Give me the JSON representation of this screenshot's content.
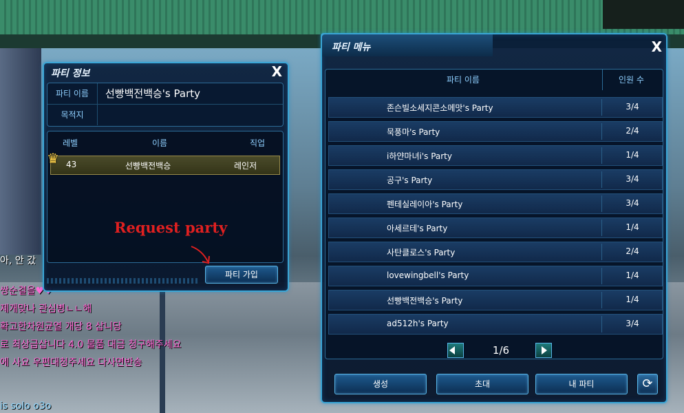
{
  "party_info": {
    "title": "파티 정보",
    "close_label": "X",
    "party_name_label": "파티 이름",
    "party_name_value": "선빵백전백승's Party",
    "destination_label": "목적지",
    "destination_value": "",
    "columns": {
      "level": "레벨",
      "name": "이름",
      "job": "직업"
    },
    "members": [
      {
        "level": "43",
        "name": "선빵백전백승",
        "job": "레인저"
      }
    ],
    "join_button": "파티 가입"
  },
  "annotation": "Request party",
  "party_menu": {
    "title": "파티 메뉴",
    "close_label": "X",
    "columns": {
      "name": "파티 이름",
      "count": "인원 수"
    },
    "parties": [
      {
        "name": "존슨빌소세지콘소메맛's Party",
        "count": "3/4"
      },
      {
        "name": "묵풍마's Party",
        "count": "2/4"
      },
      {
        "name": "i하얀마녀i's Party",
        "count": "1/4"
      },
      {
        "name": "공구's Party",
        "count": "3/4"
      },
      {
        "name": "펜테실레이아's Party",
        "count": "3/4"
      },
      {
        "name": "아세르테's Party",
        "count": "1/4"
      },
      {
        "name": "사탄클로스's Party",
        "count": "2/4"
      },
      {
        "name": "lovewingbell's Party",
        "count": "1/4"
      },
      {
        "name": "선빵백전백승's Party",
        "count": "1/4"
      },
      {
        "name": "ad512h's Party",
        "count": "3/4"
      }
    ],
    "page": "1/6",
    "buttons": {
      "create": "생성",
      "invite": "초대",
      "my_party": "내 파티",
      "refresh_icon": "refresh-icon"
    }
  },
  "chat": [
    {
      "text": "아, 안 갔",
      "color": "#ffffff"
    },
    {
      "text": "쌍순결을♥♥",
      "color": "#ff6ad5"
    },
    {
      "text": "제개맞나 관심병ㄴㄴ해",
      "color": "#ff6ad5"
    },
    {
      "text": "확고한차원균열 개당 8 삽니당",
      "color": "#ff6ad5"
    },
    {
      "text": "로 최상급삽니다 4.0 물품 대금 청구해주세요",
      "color": "#ff6ad5"
    },
    {
      "text": "에 사요 우편대청주세요 다사면반송",
      "color": "#ff6ad5"
    },
    {
      "text": "is solo o3o",
      "color": "#8fd8ff"
    }
  ],
  "colors": {
    "accent": "#3aa6d6",
    "panel": "#0a1e3a",
    "annotation": "#e02020",
    "crown": "#ffd34a"
  }
}
